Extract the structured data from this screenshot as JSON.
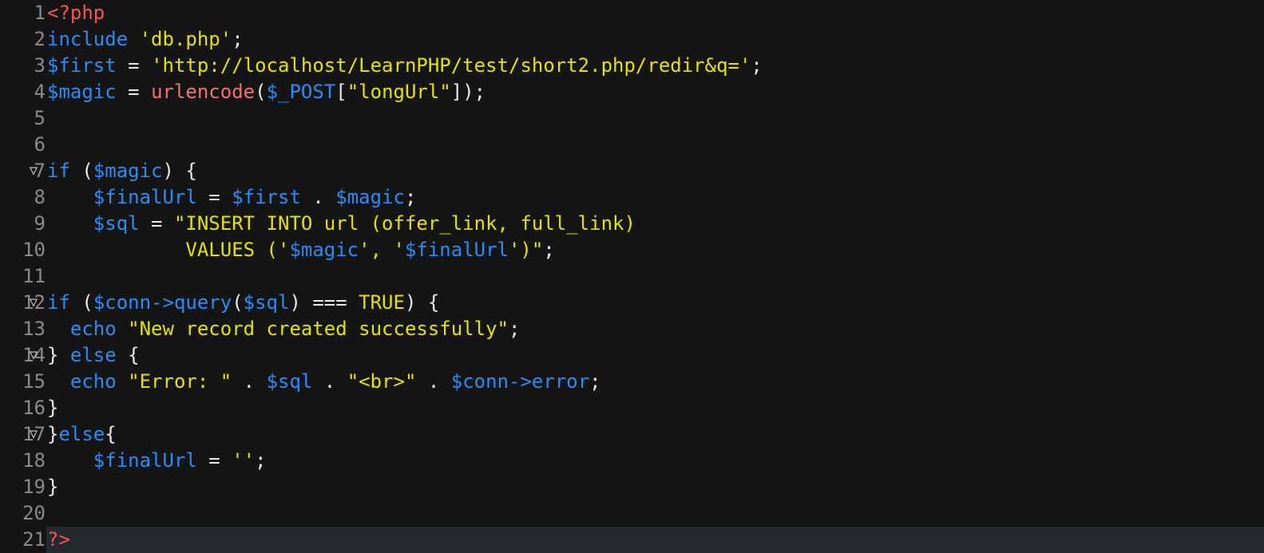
{
  "editor": {
    "language": "php",
    "background_color": "#151515",
    "gutter_color": "#8a8a8a",
    "current_line_highlight_color": "#252930",
    "fold_marker_glyph": "▽",
    "total_visible_lines": 21,
    "current_line_number": 21,
    "colors": {
      "php_tag": "#f4574f",
      "keyword": "#2b8cf5",
      "variable": "#2b8cf5",
      "string": "#e3e300",
      "function": "#f07178",
      "constant": "#e3e300",
      "punctuation": "#e8e8e8"
    }
  },
  "lines": [
    {
      "number": "1",
      "fold": "",
      "current": false,
      "tokens": [
        {
          "text": "<?php",
          "type": "t-php"
        }
      ]
    },
    {
      "number": "2",
      "fold": "",
      "current": false,
      "tokens": [
        {
          "text": "include",
          "type": "t-kw"
        },
        {
          "text": " ",
          "type": "t-punc"
        },
        {
          "text": "'db.php'",
          "type": "t-str"
        },
        {
          "text": ";",
          "type": "t-punc"
        }
      ]
    },
    {
      "number": "3",
      "fold": "",
      "current": false,
      "tokens": [
        {
          "text": "$first",
          "type": "t-var"
        },
        {
          "text": " = ",
          "type": "t-punc"
        },
        {
          "text": "'http://localhost/LearnPHP/test/short2.php/redir&q='",
          "type": "t-str"
        },
        {
          "text": ";",
          "type": "t-punc"
        }
      ]
    },
    {
      "number": "4",
      "fold": "",
      "current": false,
      "tokens": [
        {
          "text": "$magic",
          "type": "t-var"
        },
        {
          "text": " = ",
          "type": "t-punc"
        },
        {
          "text": "urlencode",
          "type": "t-fn"
        },
        {
          "text": "(",
          "type": "t-punc"
        },
        {
          "text": "$_POST",
          "type": "t-var"
        },
        {
          "text": "[",
          "type": "t-punc"
        },
        {
          "text": "\"longUrl\"",
          "type": "t-str"
        },
        {
          "text": "]);",
          "type": "t-punc"
        }
      ]
    },
    {
      "number": "5",
      "fold": "",
      "current": false,
      "tokens": []
    },
    {
      "number": "6",
      "fold": "",
      "current": false,
      "tokens": []
    },
    {
      "number": "7",
      "fold": "▽",
      "current": false,
      "tokens": [
        {
          "text": "if",
          "type": "t-kw"
        },
        {
          "text": " (",
          "type": "t-punc"
        },
        {
          "text": "$magic",
          "type": "t-var"
        },
        {
          "text": ") {",
          "type": "t-punc"
        }
      ]
    },
    {
      "number": "8",
      "fold": "",
      "current": false,
      "tokens": [
        {
          "text": "    ",
          "type": "t-punc"
        },
        {
          "text": "$finalUrl",
          "type": "t-var"
        },
        {
          "text": " = ",
          "type": "t-punc"
        },
        {
          "text": "$first",
          "type": "t-var"
        },
        {
          "text": " . ",
          "type": "t-punc"
        },
        {
          "text": "$magic",
          "type": "t-var"
        },
        {
          "text": ";",
          "type": "t-punc"
        }
      ]
    },
    {
      "number": "9",
      "fold": "",
      "current": false,
      "tokens": [
        {
          "text": "    ",
          "type": "t-punc"
        },
        {
          "text": "$sql",
          "type": "t-var"
        },
        {
          "text": " = ",
          "type": "t-punc"
        },
        {
          "text": "\"INSERT INTO url (offer_link, full_link)",
          "type": "t-str"
        }
      ]
    },
    {
      "number": "10",
      "fold": "",
      "current": false,
      "tokens": [
        {
          "text": "            VALUES ('",
          "type": "t-str"
        },
        {
          "text": "$magic",
          "type": "t-strv"
        },
        {
          "text": "', '",
          "type": "t-str"
        },
        {
          "text": "$finalUrl",
          "type": "t-strv"
        },
        {
          "text": "')\"",
          "type": "t-str"
        },
        {
          "text": ";",
          "type": "t-punc"
        }
      ]
    },
    {
      "number": "11",
      "fold": "",
      "current": false,
      "tokens": []
    },
    {
      "number": "12",
      "fold": "▽",
      "current": false,
      "tokens": [
        {
          "text": "if",
          "type": "t-kw"
        },
        {
          "text": " (",
          "type": "t-punc"
        },
        {
          "text": "$conn->query",
          "type": "t-var"
        },
        {
          "text": "(",
          "type": "t-punc"
        },
        {
          "text": "$sql",
          "type": "t-var"
        },
        {
          "text": ") === ",
          "type": "t-punc"
        },
        {
          "text": "TRUE",
          "type": "t-const"
        },
        {
          "text": ") {",
          "type": "t-punc"
        }
      ]
    },
    {
      "number": "13",
      "fold": "",
      "current": false,
      "tokens": [
        {
          "text": "  ",
          "type": "t-punc"
        },
        {
          "text": "echo",
          "type": "t-kw"
        },
        {
          "text": " ",
          "type": "t-punc"
        },
        {
          "text": "\"New record created successfully\"",
          "type": "t-str"
        },
        {
          "text": ";",
          "type": "t-punc"
        }
      ]
    },
    {
      "number": "14",
      "fold": "▽",
      "current": false,
      "tokens": [
        {
          "text": "} ",
          "type": "t-punc"
        },
        {
          "text": "else",
          "type": "t-kw"
        },
        {
          "text": " {",
          "type": "t-punc"
        }
      ]
    },
    {
      "number": "15",
      "fold": "",
      "current": false,
      "tokens": [
        {
          "text": "  ",
          "type": "t-punc"
        },
        {
          "text": "echo",
          "type": "t-kw"
        },
        {
          "text": " ",
          "type": "t-punc"
        },
        {
          "text": "\"Error: \"",
          "type": "t-str"
        },
        {
          "text": " . ",
          "type": "t-punc"
        },
        {
          "text": "$sql",
          "type": "t-var"
        },
        {
          "text": " . ",
          "type": "t-punc"
        },
        {
          "text": "\"<br>\"",
          "type": "t-str"
        },
        {
          "text": " . ",
          "type": "t-punc"
        },
        {
          "text": "$conn->error",
          "type": "t-var"
        },
        {
          "text": ";",
          "type": "t-punc"
        }
      ]
    },
    {
      "number": "16",
      "fold": "",
      "current": false,
      "tokens": [
        {
          "text": "}",
          "type": "t-punc"
        }
      ]
    },
    {
      "number": "17",
      "fold": "▽",
      "current": false,
      "tokens": [
        {
          "text": "}",
          "type": "t-punc"
        },
        {
          "text": "else",
          "type": "t-kw"
        },
        {
          "text": "{",
          "type": "t-punc"
        }
      ]
    },
    {
      "number": "18",
      "fold": "",
      "current": false,
      "tokens": [
        {
          "text": "    ",
          "type": "t-punc"
        },
        {
          "text": "$finalUrl",
          "type": "t-var"
        },
        {
          "text": " = ",
          "type": "t-punc"
        },
        {
          "text": "''",
          "type": "t-str"
        },
        {
          "text": ";",
          "type": "t-punc"
        }
      ]
    },
    {
      "number": "19",
      "fold": "",
      "current": false,
      "tokens": [
        {
          "text": "}",
          "type": "t-punc"
        }
      ]
    },
    {
      "number": "20",
      "fold": "",
      "current": false,
      "tokens": []
    },
    {
      "number": "21",
      "fold": "",
      "current": true,
      "tokens": [
        {
          "text": "?>",
          "type": "t-php"
        }
      ]
    }
  ]
}
